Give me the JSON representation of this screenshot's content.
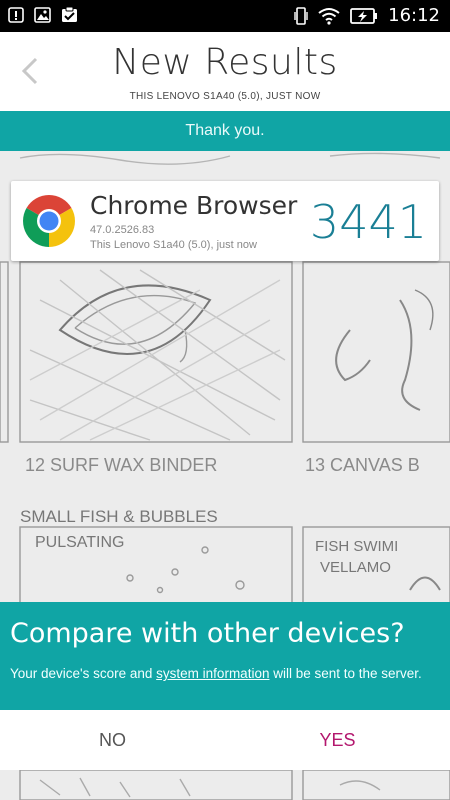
{
  "status_bar": {
    "time": "16:12"
  },
  "header": {
    "title": "New Results",
    "subtitle": "THIS LENOVO S1A40 (5.0), JUST NOW"
  },
  "banner": {
    "text": "Thank you."
  },
  "result": {
    "name": "Chrome Browser",
    "version": "47.0.2526.83",
    "device": "This Lenovo S1a40 (5.0), just now",
    "score": "3441"
  },
  "background_sketch": {
    "caption_12": "12  SURF WAX BINDER",
    "caption_13": "13  CANVAS B",
    "panel_left_title": "SMALL FISH & BUBBLES",
    "panel_left_sub": "PULSATING",
    "panel_right_title": "FISH SWIMI",
    "panel_right_sub": "VELLAMO"
  },
  "dialog": {
    "title": "Compare with other devices?",
    "text_before": "Your device's score and ",
    "link": "system information",
    "text_after": " will be sent to the server.",
    "no_label": "NO",
    "yes_label": "YES"
  }
}
